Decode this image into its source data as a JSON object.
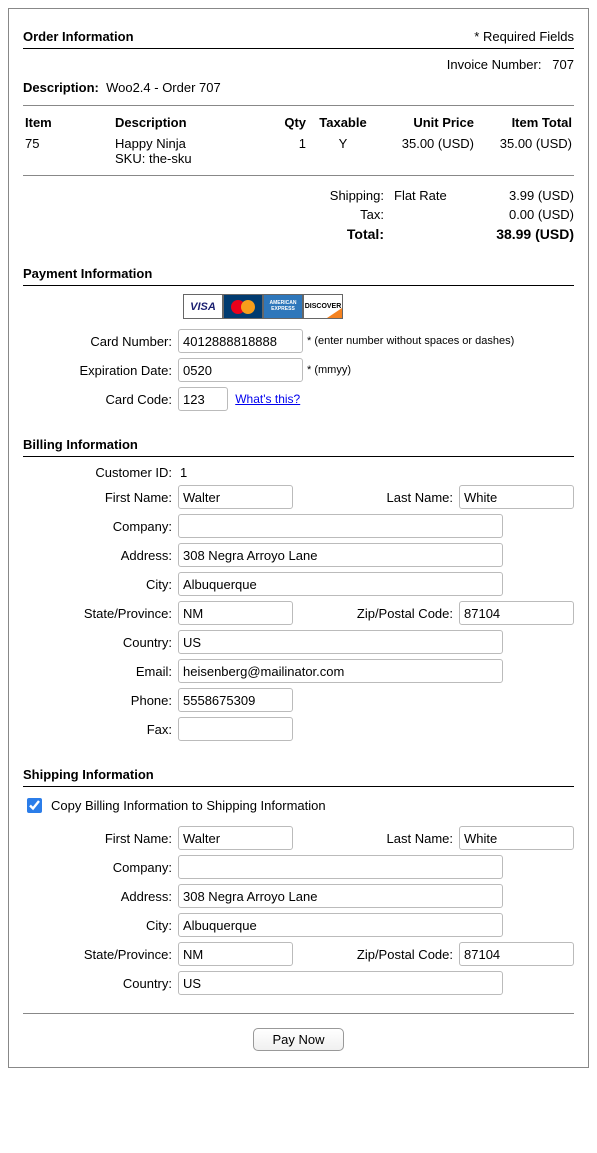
{
  "order": {
    "title": "Order Information",
    "required_note": "* Required Fields",
    "invoice_label": "Invoice Number:",
    "invoice_number": "707",
    "description_label": "Description:",
    "description_value": "Woo2.4 - Order 707",
    "headers": {
      "item": "Item",
      "description": "Description",
      "qty": "Qty",
      "taxable": "Taxable",
      "unit_price": "Unit Price",
      "item_total": "Item Total"
    },
    "line": {
      "item": "75",
      "desc1": "Happy Ninja",
      "desc2": "SKU: the-sku",
      "qty": "1",
      "taxable": "Y",
      "unit_price": "35.00 (USD)",
      "item_total": "35.00 (USD)"
    },
    "totals": {
      "shipping_label": "Shipping:",
      "shipping_method": "Flat Rate",
      "shipping_value": "3.99 (USD)",
      "tax_label": "Tax:",
      "tax_value": "0.00 (USD)",
      "total_label": "Total:",
      "total_value": "38.99 (USD)"
    }
  },
  "payment": {
    "title": "Payment Information",
    "card_number_label": "Card Number:",
    "card_number_value": "4012888818888",
    "card_number_hint": "* (enter number without spaces or dashes)",
    "exp_label": "Expiration Date:",
    "exp_value": "0520",
    "exp_hint": "* (mmyy)",
    "code_label": "Card Code:",
    "code_value": "123",
    "whats_this": "What's this?"
  },
  "billing": {
    "title": "Billing Information",
    "customer_id_label": "Customer ID:",
    "customer_id_value": "1",
    "first_name_label": "First Name:",
    "first_name": "Walter",
    "last_name_label": "Last Name:",
    "last_name": "White",
    "company_label": "Company:",
    "company": "",
    "address_label": "Address:",
    "address": "308 Negra Arroyo Lane",
    "city_label": "City:",
    "city": "Albuquerque",
    "state_label": "State/Province:",
    "state": "NM",
    "zip_label": "Zip/Postal Code:",
    "zip": "87104",
    "country_label": "Country:",
    "country": "US",
    "email_label": "Email:",
    "email": "heisenberg@mailinator.com",
    "phone_label": "Phone:",
    "phone": "5558675309",
    "fax_label": "Fax:",
    "fax": ""
  },
  "shipping": {
    "title": "Shipping Information",
    "copy_label": "Copy Billing Information to Shipping Information",
    "first_name_label": "First Name:",
    "first_name": "Walter",
    "last_name_label": "Last Name:",
    "last_name": "White",
    "company_label": "Company:",
    "company": "",
    "address_label": "Address:",
    "address": "308 Negra Arroyo Lane",
    "city_label": "City:",
    "city": "Albuquerque",
    "state_label": "State/Province:",
    "state": "NM",
    "zip_label": "Zip/Postal Code:",
    "zip": "87104",
    "country_label": "Country:",
    "country": "US"
  },
  "action": {
    "pay_label": "Pay Now"
  }
}
